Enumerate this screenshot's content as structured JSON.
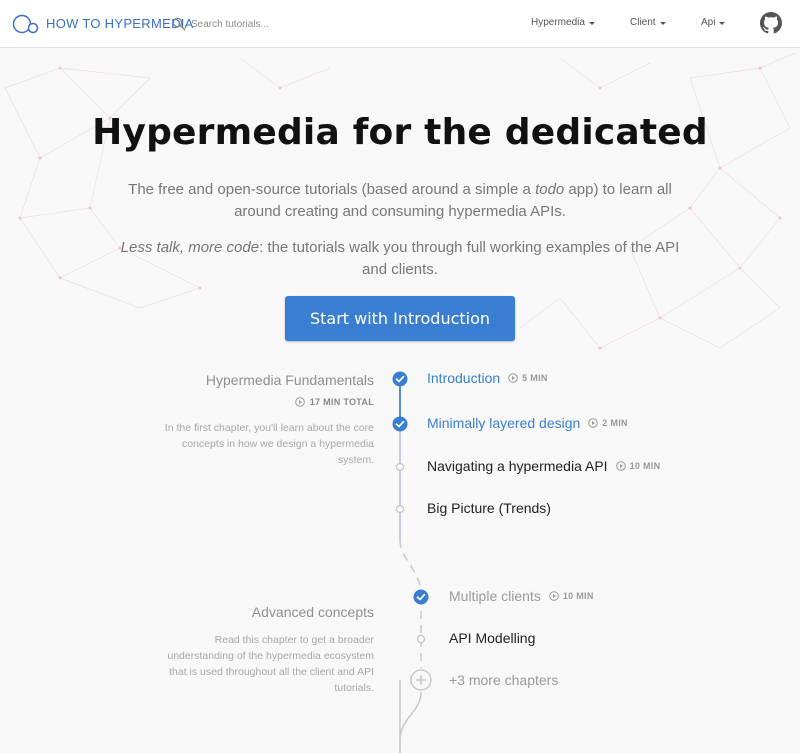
{
  "navbar": {
    "brand": "HOW TO HYPERMEDIA",
    "search_placeholder": "Search tutorials...",
    "menus": [
      "Hypermedia",
      "Client",
      "Api"
    ],
    "icons": [
      "logo-icon",
      "search-icon",
      "github-icon"
    ]
  },
  "hero": {
    "title": "Hypermedia for the dedicated",
    "p1_before": "The free and open-source tutorials (based around a simple a ",
    "p1_em": "todo",
    "p1_after": " app) to learn all around creating and consuming hypermedia APIs.",
    "p2_em": "Less talk, more code",
    "p2_after": ": the tutorials walk you through full working examples of the API and clients.",
    "cta_label": "Start with Introduction"
  },
  "chapters": [
    {
      "title": "Hypermedia Fundamentals",
      "total": "17 MIN TOTAL",
      "description": "In the first chapter, you'll learn about the core concepts in how we design a hypermedia system.",
      "lessons": [
        {
          "name": "Introduction",
          "duration": "5 MIN",
          "completed": true
        },
        {
          "name": "Minimally layered design",
          "duration": "2 MIN",
          "completed": true
        },
        {
          "name": "Navigating a hypermedia API",
          "duration": "10 MIN",
          "completed": false
        },
        {
          "name": "Big Picture (Trends)",
          "duration": "",
          "completed": false
        }
      ]
    },
    {
      "title": "Advanced concepts",
      "description": "Read this chapter to get a broader understanding of the hypermedia ecosystem that is used throughout all the client and API tutorials.",
      "lessons": [
        {
          "name": "Multiple clients",
          "duration": "10 MIN",
          "completed": true
        },
        {
          "name": "API Modelling",
          "duration": "",
          "completed": false
        }
      ],
      "more_label": "+3 more chapters"
    }
  ],
  "colors": {
    "accent": "#3a7ed2",
    "brand_text": "#3a6fc4",
    "muted_text": "#9a9a9a",
    "background": "#f8f8f9"
  }
}
